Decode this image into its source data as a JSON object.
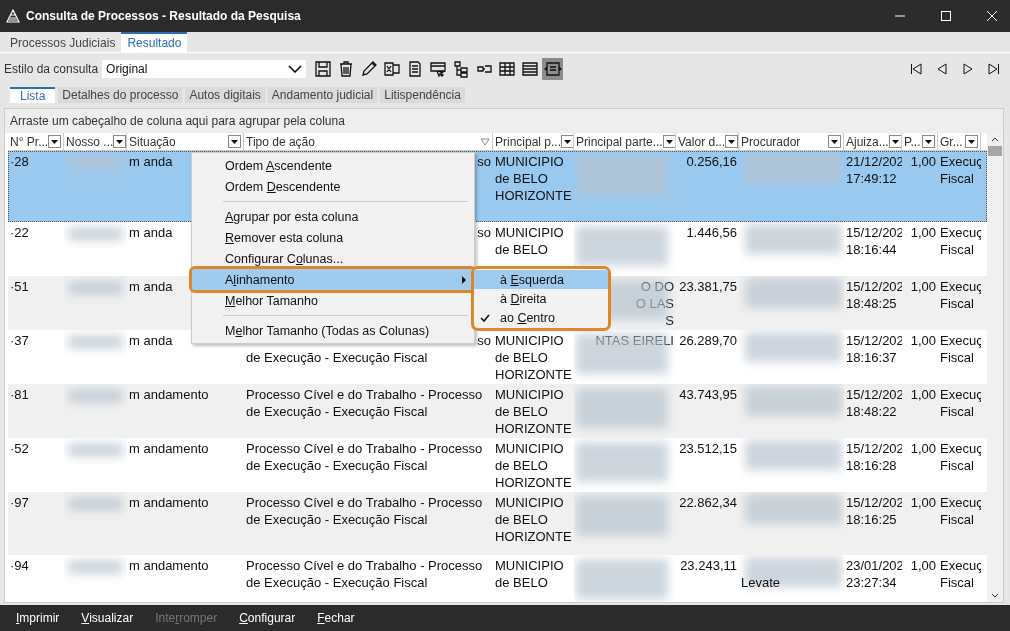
{
  "window": {
    "title": "Consulta de Processos - Resultado da Pesquisa"
  },
  "outer_tabs": [
    {
      "label": "Processos Judiciais",
      "selected": false
    },
    {
      "label": "Resultado",
      "selected": true
    }
  ],
  "toolbar": {
    "style_label": "Estilo da consulta",
    "style_value": "Original",
    "buttons": [
      {
        "pressed": false
      },
      {
        "pressed": false
      },
      {
        "pressed": false
      },
      {
        "pressed": false
      },
      {
        "pressed": false
      },
      {
        "pressed": false
      },
      {
        "pressed": false
      },
      {
        "pressed": false
      },
      {
        "pressed": false
      },
      {
        "pressed": false
      },
      {
        "pressed": true
      }
    ]
  },
  "inner_tabs": [
    {
      "label": "Lista",
      "selected": true
    },
    {
      "label": "Detalhes do processo",
      "selected": false
    },
    {
      "label": "Autos digitais",
      "selected": false
    },
    {
      "label": "Andamento judicial",
      "selected": false
    },
    {
      "label": "Litispendência",
      "selected": false
    }
  ],
  "group_hint": "Arraste um cabeçalho de coluna aqui para agrupar pela coluna",
  "columns": [
    {
      "label": "N° Pr...",
      "filter": true
    },
    {
      "label": "Nosso ...",
      "filter": true
    },
    {
      "label": "Situação",
      "filter": true
    },
    {
      "label": "Tipo de ação",
      "filter": false
    },
    {
      "label": "Principal p...",
      "filter": true
    },
    {
      "label": "Principal parte...",
      "filter": true
    },
    {
      "label": "Valor d...",
      "filter": true
    },
    {
      "label": "Procurador",
      "filter": true
    },
    {
      "label": "Ajuiza...",
      "filter": true
    },
    {
      "label": "P...",
      "filter": true
    },
    {
      "label": "Gr...",
      "filter": true
    }
  ],
  "rows": [
    {
      "selected": true,
      "num": "·28",
      "situacao": "m anda",
      "tipo": [
        {
          "text": "so",
          "tail": true
        }
      ],
      "principal": [
        "MUNICIPIO",
        "de BELO",
        "HORIZONTE"
      ],
      "parte": [],
      "valor": "0.256,16",
      "procurador": [],
      "ajuizamento": [
        "21/12/202",
        "17:49:12"
      ],
      "p": "1,00",
      "gr": [
        "Execuç",
        "Fiscal"
      ]
    },
    {
      "selected": false,
      "num": "·22",
      "situacao": "m anda",
      "tipo": [
        {
          "text": "so",
          "tail": true
        }
      ],
      "principal": [
        "MUNICIPIO",
        "de BELO"
      ],
      "parte": [],
      "valor": "1.446,56",
      "procurador": [],
      "ajuizamento": [
        "15/12/202",
        "18:16:44"
      ],
      "p": "1,00",
      "gr": [
        "Execuç",
        "Fiscal"
      ]
    },
    {
      "selected": false,
      "num": "·51",
      "situacao": "m anda",
      "tipo": [],
      "principal": [],
      "parte": [
        {
          "text": "O DO",
          "tail": true
        },
        {
          "text": "O LAS",
          "tail": true
        },
        {
          "text": "S",
          "tail": true
        }
      ],
      "valor": "23.381,75",
      "procurador": [],
      "ajuizamento": [
        "15/12/202",
        "18:48:25"
      ],
      "p": "1,00",
      "gr": [
        "Execuç",
        "Fiscal"
      ]
    },
    {
      "selected": false,
      "num": "·37",
      "situacao": "m anda",
      "tipo": [
        {
          "text": "so",
          "tail": true
        },
        {
          "text": "de Execução - Execução Fiscal",
          "tail": false
        }
      ],
      "principal": [
        "MUNICIPIO",
        "de BELO",
        "HORIZONTE"
      ],
      "parte": [
        {
          "text": "NTAS EIRELI",
          "tail": true
        }
      ],
      "valor": "26.289,70",
      "procurador": [],
      "ajuizamento": [
        "15/12/202",
        "18:16:37"
      ],
      "p": "1,00",
      "gr": [
        "Execuç",
        "Fiscal"
      ]
    },
    {
      "selected": false,
      "num": "·81",
      "situacao": "m andamento",
      "tipo": [
        {
          "text": "Processo Cível e do Trabalho - Processo",
          "tail": false
        },
        {
          "text": "de Execução - Execução Fiscal",
          "tail": false
        }
      ],
      "principal": [
        "MUNICIPIO",
        "de BELO",
        "HORIZONTE"
      ],
      "parte": [],
      "valor": "43.743,95",
      "procurador": [],
      "ajuizamento": [
        "15/12/202",
        "18:48:22"
      ],
      "p": "1,00",
      "gr": [
        "Execuç",
        "Fiscal"
      ]
    },
    {
      "selected": false,
      "num": "·52",
      "situacao": "m andamento",
      "tipo": [
        {
          "text": "Processo Cível e do Trabalho - Processo",
          "tail": false
        },
        {
          "text": "de Execução - Execução Fiscal",
          "tail": false
        }
      ],
      "principal": [
        "MUNICIPIO",
        "de BELO",
        "HORIZONTE"
      ],
      "parte": [],
      "valor": "23.512,15",
      "procurador": [],
      "ajuizamento": [
        "15/12/202",
        "18:16:28"
      ],
      "p": "1,00",
      "gr": [
        "Execuç",
        "Fiscal"
      ]
    },
    {
      "selected": false,
      "num": "·97",
      "situacao": "m andamento",
      "tipo": [
        {
          "text": "Processo Cível e do Trabalho - Processo",
          "tail": false
        },
        {
          "text": "de Execução - Execução Fiscal",
          "tail": false
        }
      ],
      "principal": [
        "MUNICIPIO",
        "de BELO",
        "HORIZONTE"
      ],
      "parte": [],
      "valor": "22.862,34",
      "procurador": [],
      "ajuizamento": [
        "15/12/202",
        "18:16:25"
      ],
      "p": "1,00",
      "gr": [
        "Execuç",
        "Fiscal"
      ]
    },
    {
      "selected": false,
      "num": "·94",
      "situacao": "m andamento",
      "tipo": [
        {
          "text": "Processo Cível e do Trabalho - Processo",
          "tail": false
        },
        {
          "text": "de Execução - Execução Fiscal",
          "tail": false
        }
      ],
      "principal": [
        "MUNICIPIO",
        "de BELO"
      ],
      "parte": [],
      "valor": "23.243,11",
      "procurador": [
        "Levate"
      ],
      "ajuizamento": [
        "23/01/202",
        "23:27:34"
      ],
      "p": "1,00",
      "gr": [
        "Execuç",
        "Fiscal"
      ]
    }
  ],
  "context_menu": {
    "items": [
      {
        "kind": "item",
        "before": "Ordem ",
        "key": "A",
        "after": "scendente",
        "selected": false,
        "submenu": false
      },
      {
        "kind": "item",
        "before": "Ordem ",
        "key": "D",
        "after": "escendente",
        "selected": false,
        "submenu": false
      },
      {
        "kind": "separator"
      },
      {
        "kind": "item",
        "key": "A",
        "after": "grupar por esta coluna",
        "selected": false,
        "submenu": false
      },
      {
        "kind": "item",
        "key": "R",
        "after": "emover esta coluna",
        "selected": false,
        "submenu": false
      },
      {
        "kind": "item",
        "before": "Configurar C",
        "key": "o",
        "after": "lunas...",
        "selected": false,
        "submenu": false
      },
      {
        "kind": "item",
        "before": "A",
        "key": "l",
        "after": "inhamento",
        "selected": true,
        "submenu": true
      },
      {
        "kind": "item",
        "key": "M",
        "after": "elhor Tamanho",
        "selected": false,
        "submenu": false
      },
      {
        "kind": "separator"
      },
      {
        "kind": "item",
        "before": "M",
        "key": "e",
        "after": "lhor Tamanho (Todas as Colunas)",
        "selected": false,
        "submenu": false
      }
    ]
  },
  "submenu": {
    "items": [
      {
        "before": "à ",
        "key": "E",
        "after": "squerda",
        "selected": true,
        "checked": false
      },
      {
        "before": "à ",
        "key": "D",
        "after": "ireita",
        "selected": false,
        "checked": false
      },
      {
        "before": "ao ",
        "key": "C",
        "after": "entro",
        "selected": false,
        "checked": true
      }
    ]
  },
  "bottom_buttons": [
    {
      "key": "I",
      "after": "mprimir",
      "disabled": false
    },
    {
      "key": "V",
      "after": "isualizar",
      "disabled": false
    },
    {
      "before": "Inte",
      "key": "r",
      "after": "romper",
      "disabled": true
    },
    {
      "key": "C",
      "after": "onfigurar",
      "disabled": false
    },
    {
      "key": "F",
      "after": "echar",
      "disabled": false
    }
  ]
}
